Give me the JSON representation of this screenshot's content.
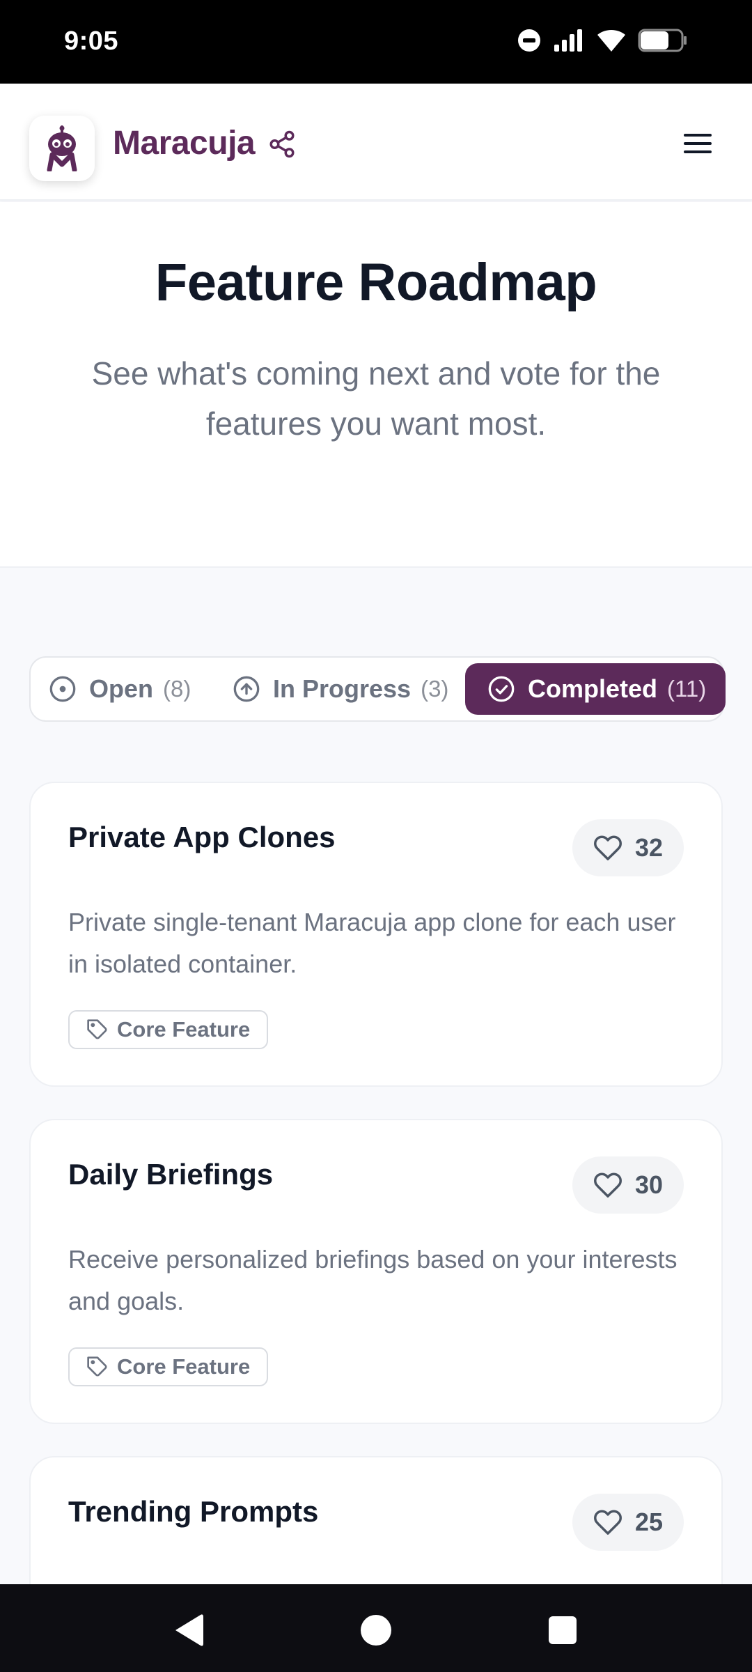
{
  "status_bar": {
    "time": "9:05"
  },
  "header": {
    "brand": "Maracuja"
  },
  "hero": {
    "title": "Feature Roadmap",
    "subtitle": "See what's coming next and vote for the features you want most."
  },
  "tabs": [
    {
      "label": "Open",
      "count": "(8)"
    },
    {
      "label": "In Progress",
      "count": "(3)"
    },
    {
      "label": "Completed",
      "count": "(11)"
    }
  ],
  "features": [
    {
      "title": "Private App Clones",
      "votes": "32",
      "description": "Private single-tenant Maracuja app clone for each user in isolated container.",
      "tag": "Core Feature"
    },
    {
      "title": "Daily Briefings",
      "votes": "30",
      "description": "Receive personalized briefings based on your interests and goals.",
      "tag": "Core Feature"
    },
    {
      "title": "Trending Prompts",
      "votes": "25"
    }
  ],
  "colors": {
    "brand": "#5c2a5a",
    "text_dark": "#111827",
    "text_muted": "#6b7280"
  },
  "icons": {
    "header": [
      "logo-icon",
      "share-icon",
      "hamburger-menu-icon"
    ],
    "tabs": [
      "circle-dot-icon",
      "arrow-up-circle-icon",
      "check-circle-icon"
    ],
    "card": [
      "heart-icon",
      "tag-icon"
    ]
  }
}
